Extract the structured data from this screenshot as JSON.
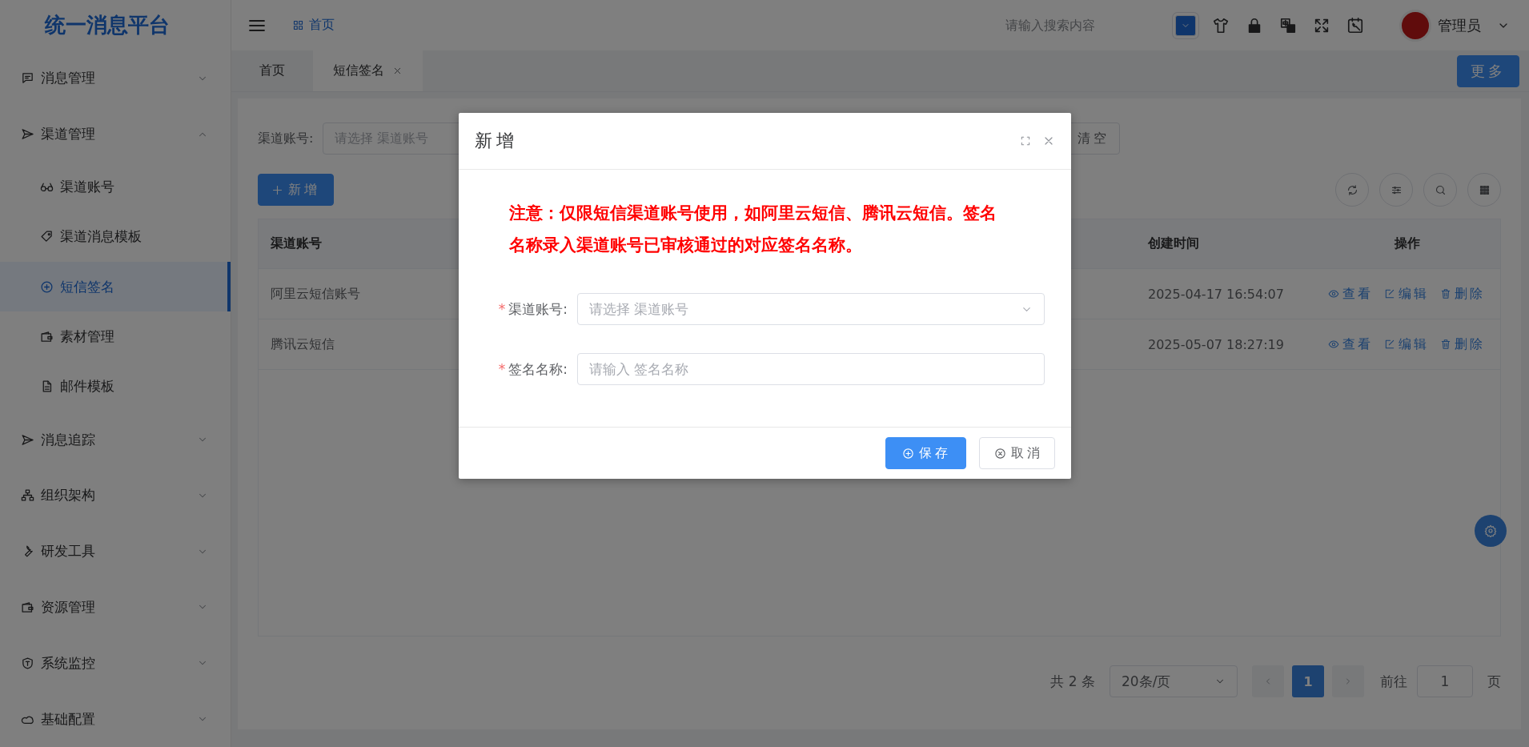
{
  "header": {
    "logo": "统一消息平台",
    "breadcrumb": "首页",
    "search": {
      "placeholder": "请输入搜索内容"
    },
    "user": "管理员"
  },
  "sidebar": {
    "items": [
      {
        "label": "消息管理",
        "expanded": false
      },
      {
        "label": "渠道管理",
        "expanded": true,
        "children": [
          {
            "label": "渠道账号",
            "selected": false
          },
          {
            "label": "渠道消息模板",
            "selected": false
          },
          {
            "label": "短信签名",
            "selected": true
          },
          {
            "label": "素材管理",
            "selected": false
          },
          {
            "label": "邮件模板",
            "selected": false
          }
        ]
      },
      {
        "label": "消息追踪",
        "expanded": false
      },
      {
        "label": "组织架构",
        "expanded": false
      },
      {
        "label": "研发工具",
        "expanded": false
      },
      {
        "label": "资源管理",
        "expanded": false
      },
      {
        "label": "系统监控",
        "expanded": false
      },
      {
        "label": "基础配置",
        "expanded": false
      }
    ]
  },
  "tabs": [
    {
      "label": "首页",
      "selected": false,
      "closable": false
    },
    {
      "label": "短信签名",
      "selected": true,
      "closable": true
    }
  ],
  "more_button": "更多",
  "search_form": {
    "label": "渠道账号:",
    "placeholder": "请选择 渠道账号",
    "clear_button": "清空"
  },
  "add_button": "新增",
  "table": {
    "columns": [
      "渠道账号",
      "创建时间",
      "操作"
    ],
    "rows": [
      {
        "account": "阿里云短信账号",
        "created": "2025-04-17 16:54:07",
        "actions": [
          "查看",
          "编辑",
          "删除"
        ]
      },
      {
        "account": "腾讯云短信",
        "created": "2025-05-07 18:27:19",
        "actions": [
          "查看",
          "编辑",
          "删除"
        ]
      }
    ]
  },
  "pagination": {
    "total": "共 2 条",
    "page_size": "20条/页",
    "pages": [
      {
        "label": "1",
        "selected": true
      }
    ],
    "goto_label": "前往",
    "goto_value": "1",
    "goto_suffix": "页"
  },
  "dialog": {
    "title": "新增",
    "notice": "注意：仅限短信渠道账号使用，如阿里云短信、腾讯云短信。签名名称录入渠道账号已审核通过的对应签名名称。",
    "fields": [
      {
        "label": "渠道账号:",
        "placeholder": "请选择 渠道账号",
        "kind": "select",
        "required_mark": "*"
      },
      {
        "label": "签名名称:",
        "placeholder": "请输入 签名名称",
        "kind": "input",
        "required_mark": "*"
      }
    ],
    "save_button": "保存",
    "cancel_button": "取消"
  }
}
